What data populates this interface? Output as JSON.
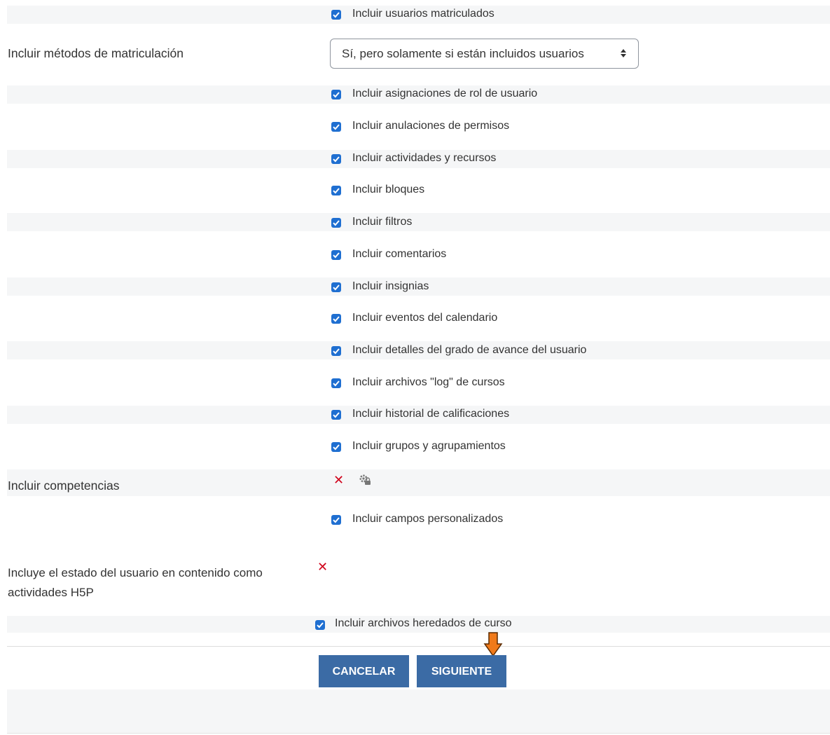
{
  "options": [
    {
      "label": "Incluir usuarios matriculados",
      "checked": true
    },
    {
      "label": "Incluir asignaciones de rol de usuario",
      "checked": true
    },
    {
      "label": "Incluir anulaciones de permisos",
      "checked": true
    },
    {
      "label": "Incluir actividades y recursos",
      "checked": true
    },
    {
      "label": "Incluir bloques",
      "checked": true
    },
    {
      "label": "Incluir filtros",
      "checked": true
    },
    {
      "label": "Incluir comentarios",
      "checked": true
    },
    {
      "label": "Incluir insignias",
      "checked": true
    },
    {
      "label": "Incluir eventos del calendario",
      "checked": true
    },
    {
      "label": "Incluir detalles del grado de avance del usuario",
      "checked": true
    },
    {
      "label": "Incluir archivos \"log\" de cursos",
      "checked": true
    },
    {
      "label": "Incluir historial de calificaciones",
      "checked": true
    },
    {
      "label": "Incluir grupos y agrupamientos",
      "checked": true
    },
    {
      "label": "Incluir campos personalizados",
      "checked": true
    },
    {
      "label": "Incluir archivos heredados de curso",
      "checked": true
    }
  ],
  "enrolment": {
    "label": "Incluir métodos de matriculación",
    "selected": "Sí, pero solamente si están incluidos usuarios"
  },
  "competencies": {
    "label": "Incluir competencias",
    "status_icon": "red-x-icon",
    "lock_icon": "gear-lock-icon"
  },
  "h5p": {
    "label_line1": "Incluye el estado del usuario en contenido como",
    "label_line2": "actividades H5P",
    "status_icon": "red-x-icon"
  },
  "buttons": {
    "cancel": "CANCELAR",
    "next": "SIGUIENTE"
  },
  "colors": {
    "checkbox": "#1f6fd1",
    "button": "#3b6ba5",
    "error": "#d0021b",
    "arrow": "#f07a1a"
  }
}
